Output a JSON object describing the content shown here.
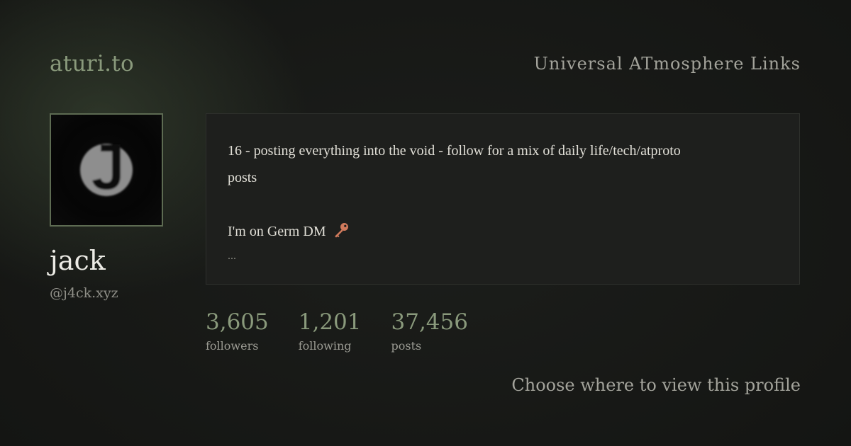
{
  "header": {
    "brand": "aturi.to",
    "tagline": "Universal ATmosphere Links"
  },
  "profile": {
    "avatar_icon": "letter-j-avatar-icon",
    "display_name": "jack",
    "handle": "@j4ck.xyz",
    "bio": {
      "line1": "16 - posting everything into the void - follow for a mix of daily life/tech/atproto",
      "line2": "posts",
      "line3": "I'm on Germ DM",
      "line3_icon": "key-icon",
      "more": "..."
    }
  },
  "stats": [
    {
      "value": "3,605",
      "label": "followers"
    },
    {
      "value": "1,201",
      "label": "following"
    },
    {
      "value": "37,456",
      "label": "posts"
    }
  ],
  "footer": {
    "cta": "Choose where to view this profile"
  },
  "colors": {
    "accent": "#8a9a7c",
    "background": "#141513",
    "card": "#1e1f1d",
    "key": "#d07a5c"
  }
}
